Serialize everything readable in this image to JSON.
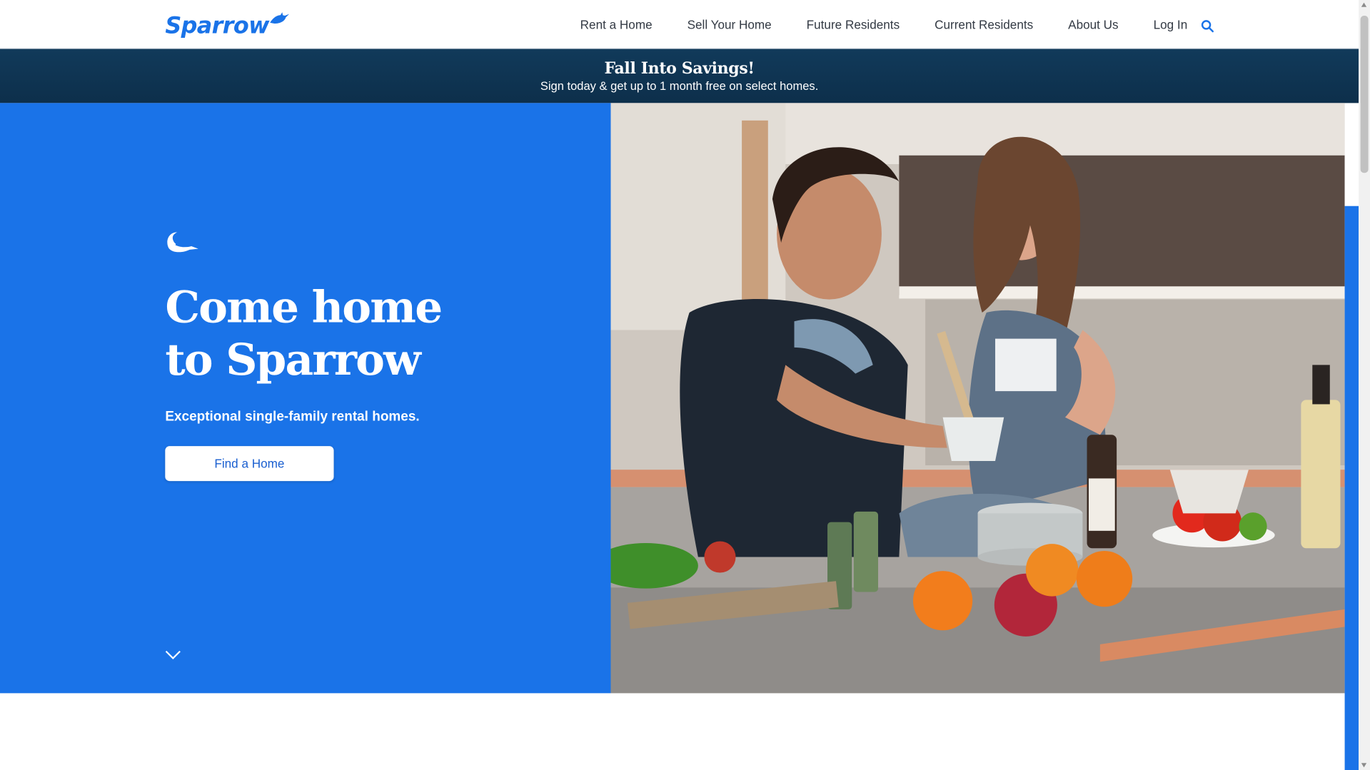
{
  "brand": {
    "name": "Sparrow",
    "color": "#1a73e8"
  },
  "nav": {
    "items": [
      {
        "label": "Rent a Home"
      },
      {
        "label": "Sell Your Home"
      },
      {
        "label": "Future Residents"
      },
      {
        "label": "Current Residents"
      },
      {
        "label": "About Us"
      },
      {
        "label": "Log In"
      }
    ],
    "search_icon": "search-icon"
  },
  "promo": {
    "title": "Fall Into Savings!",
    "subtitle": "Sign today & get up to 1 month free on select homes.",
    "background": "#113a5a"
  },
  "hero": {
    "icon": "sparrow-mark-icon",
    "title_line1": "Come home",
    "title_line2": "to Sparrow",
    "subtitle": "Exceptional single-family rental homes.",
    "cta_label": "Find a Home",
    "scroll_icon": "chevron-down-icon",
    "background": "#1a73e8"
  }
}
